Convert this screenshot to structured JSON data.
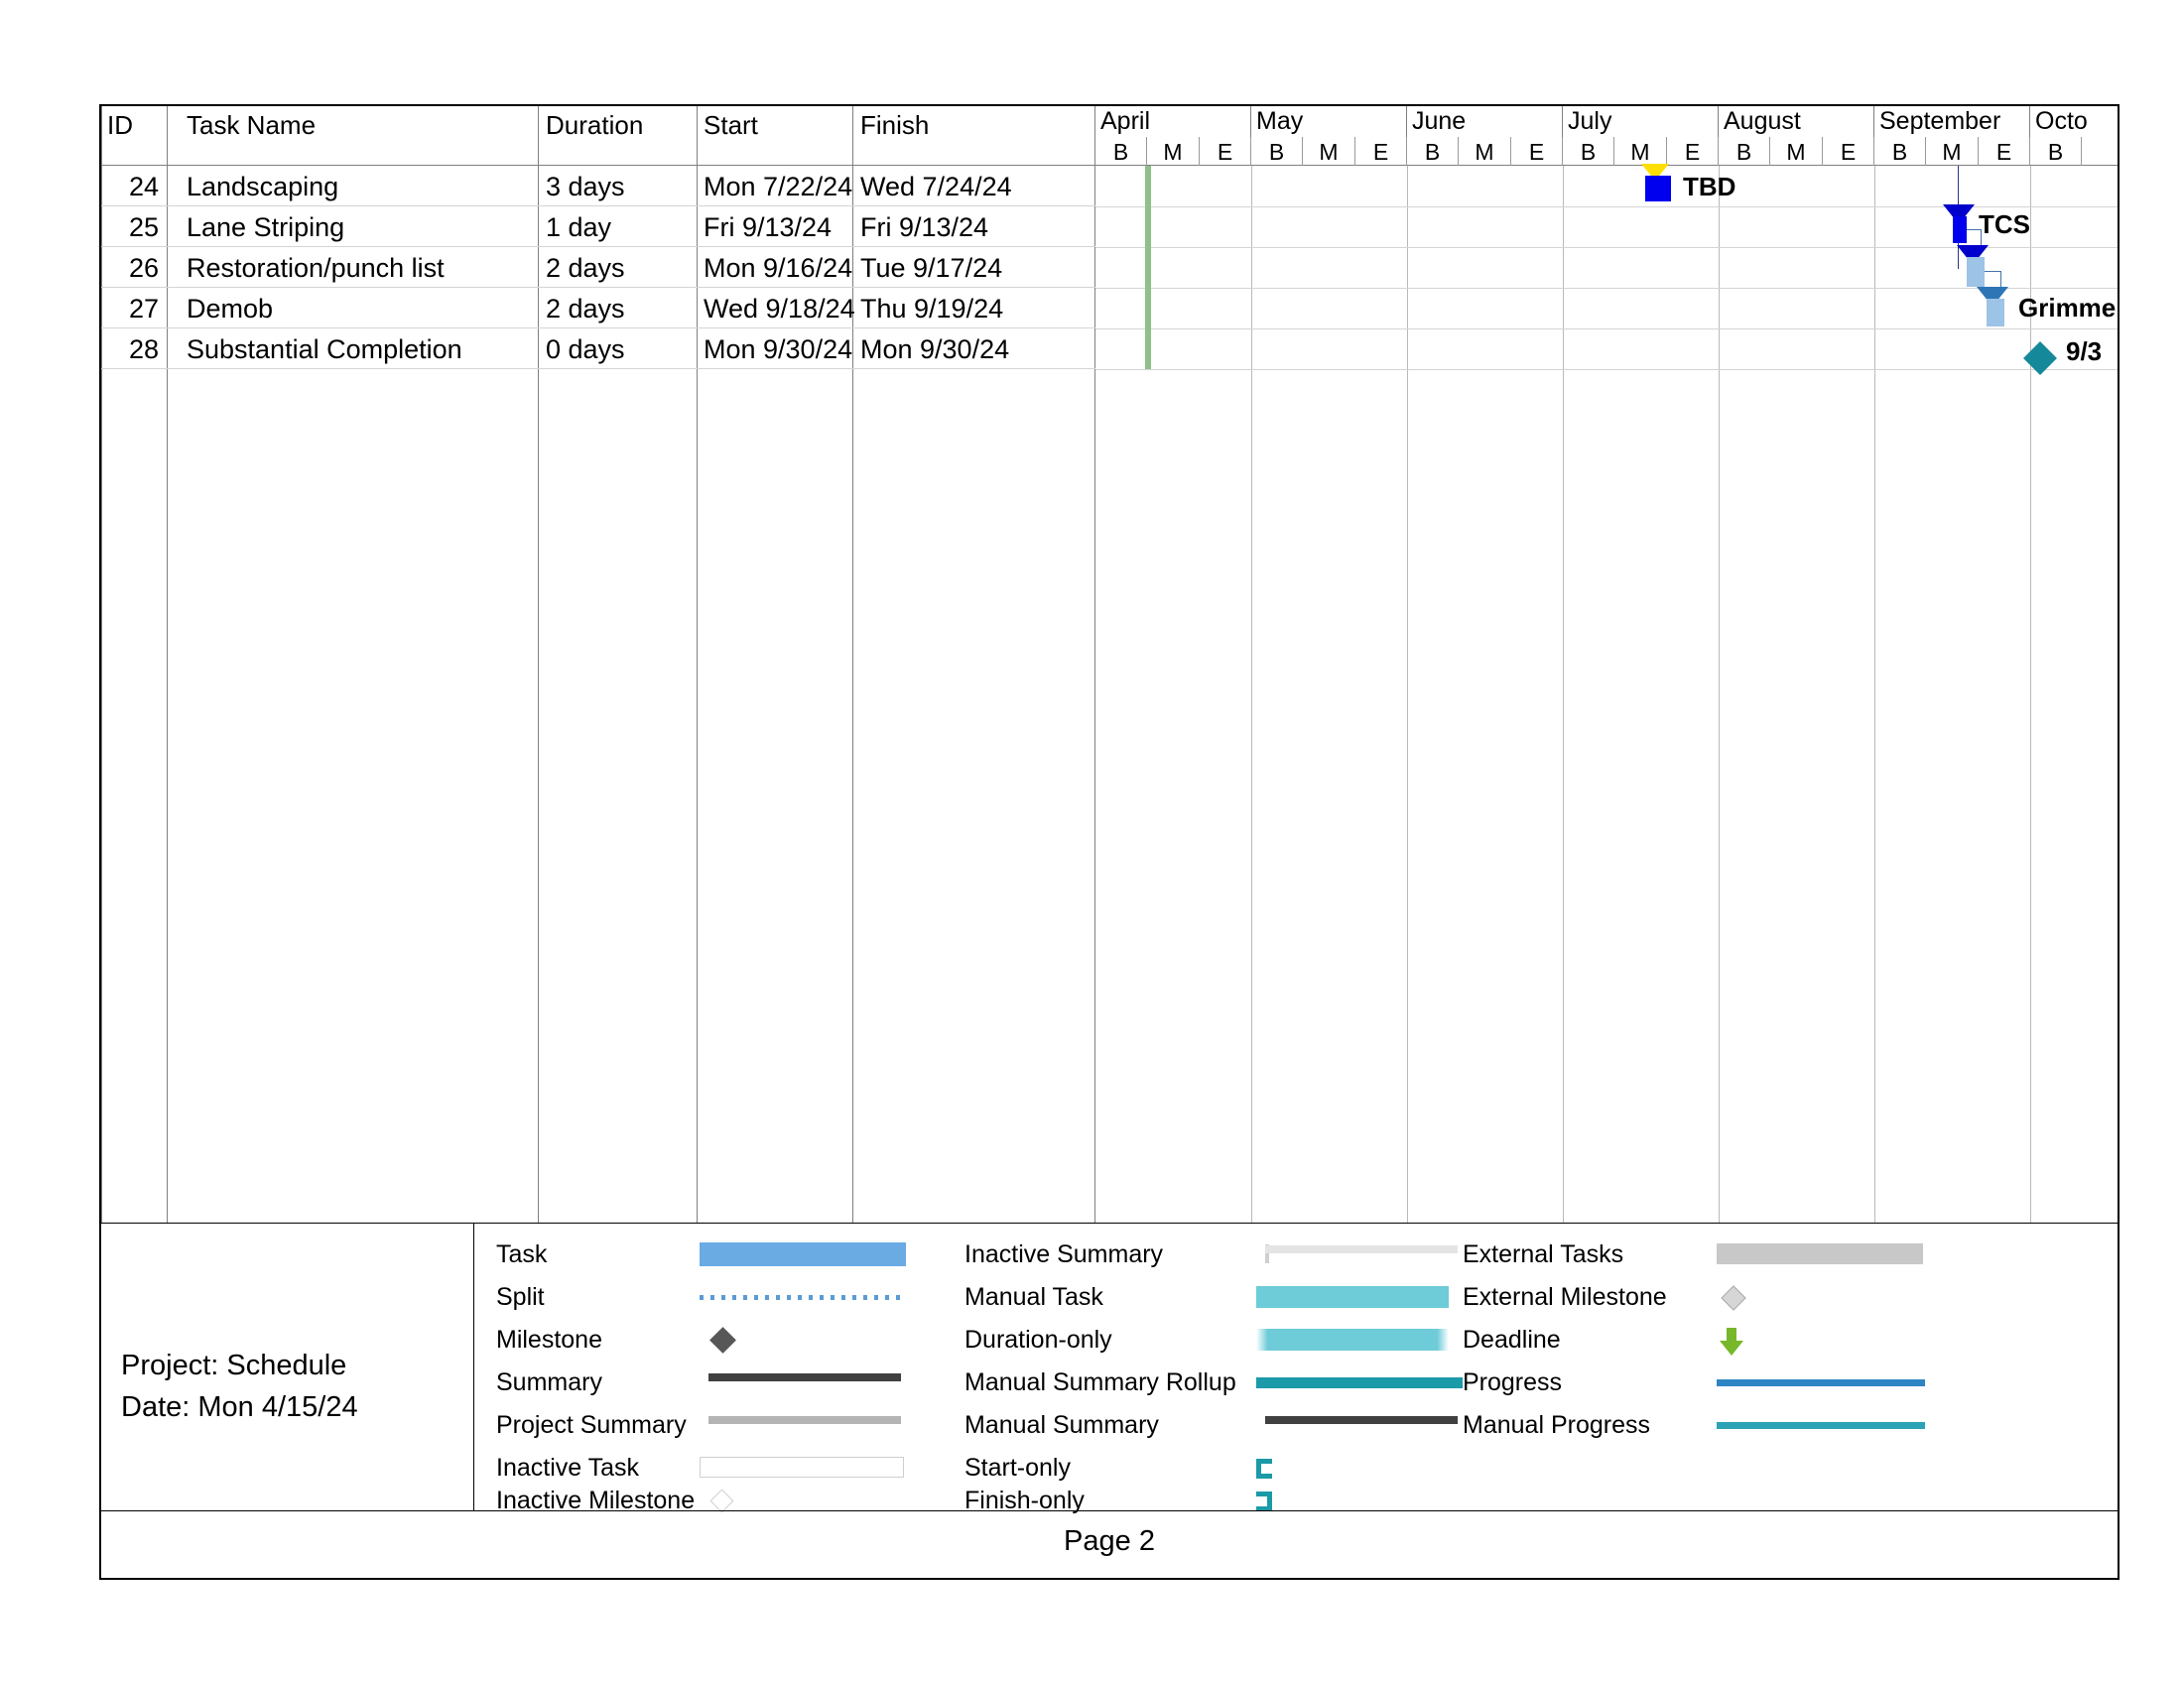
{
  "table": {
    "headers": {
      "id": "ID",
      "task_name": "Task Name",
      "duration": "Duration",
      "start": "Start",
      "finish": "Finish"
    },
    "rows": [
      {
        "id": "24",
        "name": "Landscaping",
        "duration": "3 days",
        "start": "Mon 7/22/24",
        "finish": "Wed 7/24/24"
      },
      {
        "id": "25",
        "name": "Lane Striping",
        "duration": "1 day",
        "start": "Fri 9/13/24",
        "finish": "Fri 9/13/24"
      },
      {
        "id": "26",
        "name": "Restoration/punch list",
        "duration": "2 days",
        "start": "Mon 9/16/24",
        "finish": "Tue 9/17/24"
      },
      {
        "id": "27",
        "name": "Demob",
        "duration": "2 days",
        "start": "Wed 9/18/24",
        "finish": "Thu 9/19/24"
      },
      {
        "id": "28",
        "name": "Substantial Completion",
        "duration": "0 days",
        "start": "Mon 9/30/24",
        "finish": "Mon 9/30/24"
      }
    ]
  },
  "timeline": {
    "months": [
      "April",
      "May",
      "June",
      "July",
      "August",
      "September",
      "Octo"
    ],
    "tick_labels": [
      "B",
      "M",
      "E"
    ],
    "today_marker_color": "#8ec08a"
  },
  "gantt_items": [
    {
      "row": 0,
      "kind": "deadline-arrow",
      "color": "#ffdf00"
    },
    {
      "row": 0,
      "kind": "task-bar",
      "color": "#0000ee",
      "label": "TBD"
    },
    {
      "row": 1,
      "kind": "deadline-arrow",
      "color": "#0000cc",
      "label": "TCS"
    },
    {
      "row": 1,
      "kind": "task-bar",
      "color": "#0000ee"
    },
    {
      "row": 2,
      "kind": "deadline-arrow",
      "color": "#0000cc"
    },
    {
      "row": 2,
      "kind": "task-bar",
      "color": "#9dc3e6"
    },
    {
      "row": 3,
      "kind": "deadline-arrow",
      "color": "#2e75b6",
      "label": "Grimme"
    },
    {
      "row": 3,
      "kind": "task-bar",
      "color": "#9dc3e6"
    },
    {
      "row": 4,
      "kind": "milestone",
      "color": "#15899a",
      "label": "9/3"
    }
  ],
  "legend": {
    "columns": [
      [
        {
          "label": "Task",
          "swatch": "task"
        },
        {
          "label": "Split",
          "swatch": "split"
        },
        {
          "label": "Milestone",
          "swatch": "milestone"
        },
        {
          "label": "Summary",
          "swatch": "summary"
        },
        {
          "label": "Project Summary",
          "swatch": "project-summary"
        },
        {
          "label": "Inactive Task",
          "swatch": "inactive-task"
        },
        {
          "label": "Inactive Milestone",
          "swatch": "inactive-milestone"
        }
      ],
      [
        {
          "label": "Inactive Summary",
          "swatch": "inactive-summary"
        },
        {
          "label": "Manual Task",
          "swatch": "manual-task"
        },
        {
          "label": "Duration-only",
          "swatch": "duration-only"
        },
        {
          "label": "Manual Summary Rollup",
          "swatch": "manual-summary-rollup"
        },
        {
          "label": "Manual Summary",
          "swatch": "manual-summary"
        },
        {
          "label": "Start-only",
          "swatch": "start-only"
        },
        {
          "label": "Finish-only",
          "swatch": "finish-only"
        }
      ],
      [
        {
          "label": "External Tasks",
          "swatch": "external-tasks"
        },
        {
          "label": "External Milestone",
          "swatch": "external-milestone"
        },
        {
          "label": "Deadline",
          "swatch": "deadline"
        },
        {
          "label": "Progress",
          "swatch": "progress"
        },
        {
          "label": "Manual Progress",
          "swatch": "manual-progress"
        }
      ]
    ]
  },
  "project_info": {
    "project_line": "Project: Schedule",
    "date_line": "Date: Mon 4/15/24"
  },
  "footer": {
    "page_label": "Page 2"
  }
}
